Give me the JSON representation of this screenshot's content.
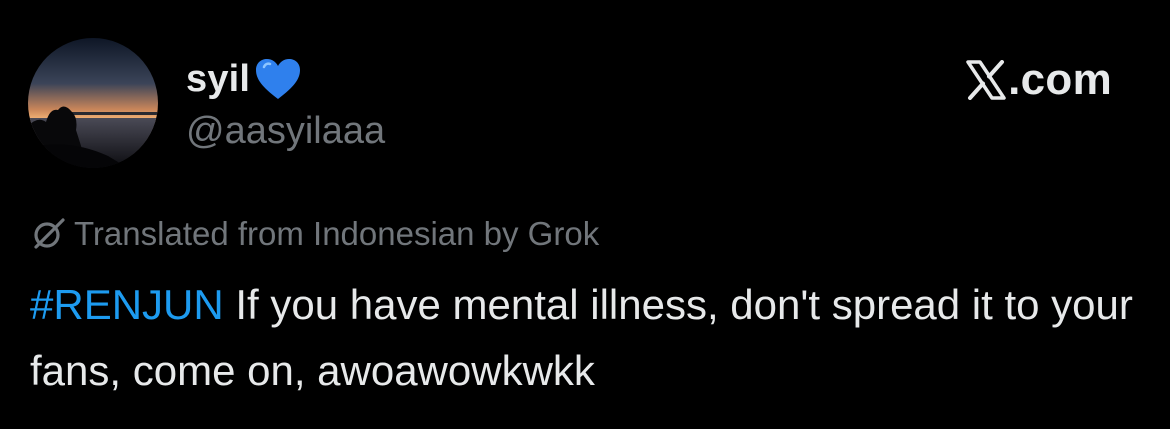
{
  "author": {
    "display_name": "syil",
    "handle": "@aasyilaaa",
    "badge_icon": "blue-heart-icon",
    "avatar_icon": "sunset-avatar"
  },
  "brand": {
    "logo_icon": "x-logo-icon",
    "text": ".com"
  },
  "translation": {
    "icon": "grok-icon",
    "text": "Translated from Indonesian by Grok"
  },
  "tweet": {
    "hashtag": "#RENJUN",
    "body": " If you have mental illness, don't spread it to your fans, come on, awoawowkwkk"
  },
  "colors": {
    "background": "#000000",
    "text_primary": "#e7e9ea",
    "text_secondary": "#71767b",
    "link": "#1d9bf0",
    "heart": "#2f80ed"
  }
}
